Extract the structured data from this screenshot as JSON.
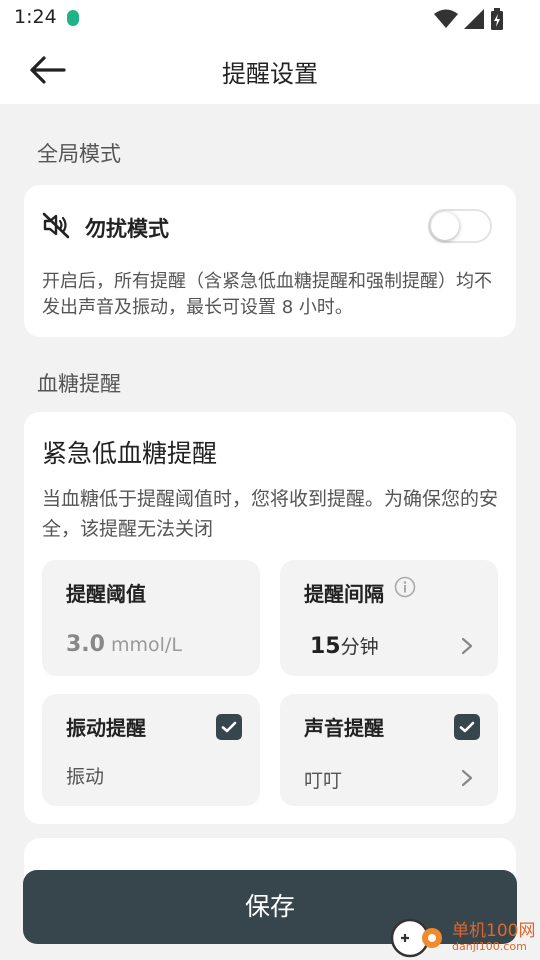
{
  "status_bar": {
    "time": "1:24"
  },
  "header": {
    "title": "提醒设置"
  },
  "sections": {
    "global": "全局模式",
    "glucose": "血糖提醒"
  },
  "dnd": {
    "title": "勿扰模式",
    "enabled": false,
    "description": "开启后，所有提醒（含紧急低血糖提醒和强制提醒）均不发出声音及振动，最长可设置 8 小时。"
  },
  "urgent_low": {
    "title": "紧急低血糖提醒",
    "description": "当血糖低于提醒阈值时，您将收到提醒。为确保您的安全，该提醒无法关闭",
    "threshold": {
      "label": "提醒阈值",
      "value": "3.0",
      "unit": "mmol/L"
    },
    "interval": {
      "label": "提醒间隔",
      "value": "15",
      "unit": "分钟"
    },
    "vibration": {
      "label": "振动提醒",
      "checked": true,
      "value": "振动"
    },
    "sound": {
      "label": "声音提醒",
      "checked": true,
      "value": "叮叮"
    }
  },
  "save_button": "保存",
  "watermark": {
    "text": "单机100网",
    "sub": "danji100.com"
  },
  "colors": {
    "primary": "#37454d",
    "background": "#f2f2f2",
    "card": "#ffffff",
    "tile": "#f3f3f3"
  }
}
